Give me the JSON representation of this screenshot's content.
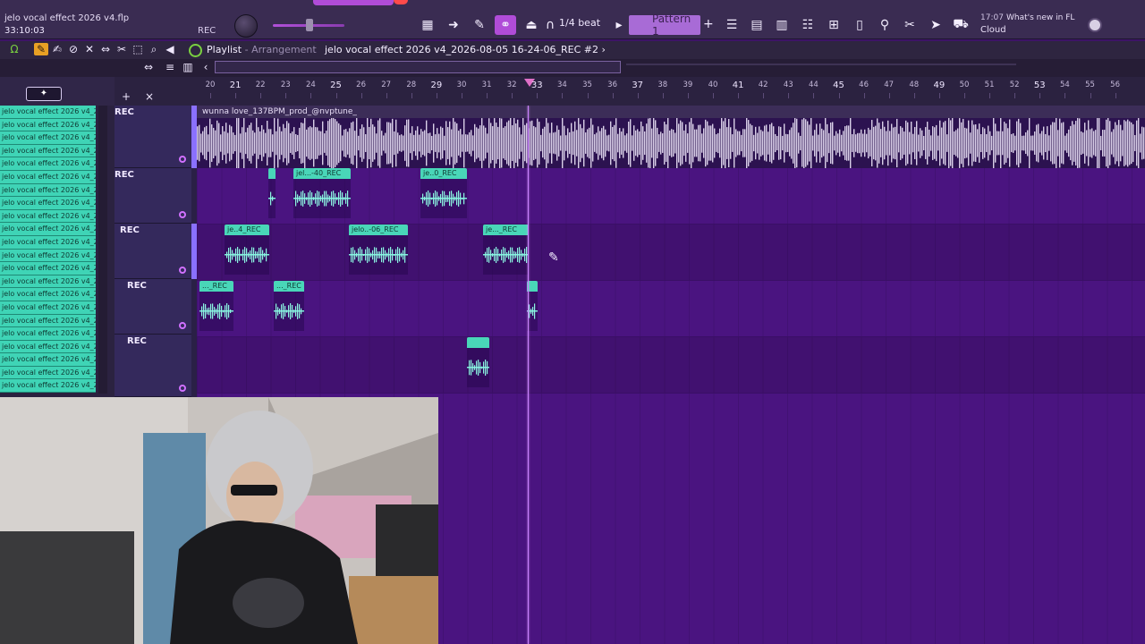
{
  "toolbar": {
    "file_title": "jelo vocal effect 2026 v4.flp",
    "elapsed": "33:10:03",
    "rec_label": "REC",
    "snap": "1/4 beat",
    "pattern": "Pattern 1",
    "news_time": "17:07",
    "news_title": "What's new in FL",
    "news_sub": "Cloud"
  },
  "playlist": {
    "title": "Playlist",
    "subtitle": "Arrangement",
    "file": "jelo vocal effect 2026 v4_2026-08-05 16-24-06_REC #2",
    "separator": " - ",
    "crumb": "›"
  },
  "ruler": {
    "numbers": [
      "20",
      "21",
      "22",
      "23",
      "24",
      "25",
      "26",
      "27",
      "28",
      "29",
      "30",
      "31",
      "32",
      "33",
      "34",
      "35",
      "36",
      "37",
      "38",
      "39",
      "40",
      "41",
      "42",
      "43",
      "44",
      "45",
      "46",
      "47",
      "48",
      "49",
      "50",
      "51",
      "52",
      "53",
      "54",
      "55",
      "56"
    ],
    "big": [
      "21",
      "25",
      "29",
      "33",
      "37",
      "41",
      "45",
      "49",
      "53"
    ]
  },
  "channels": {
    "item_label": "jelo vocal effect 2026 v4_2...",
    "count": 22
  },
  "tracks": {
    "top_controls": [
      "+",
      "×"
    ],
    "rec_labels": [
      "REC",
      "REC",
      "REC",
      "REC",
      "REC"
    ]
  },
  "audio": {
    "label": "wunna love_137BPM_prod_@nvptune_"
  },
  "clips": [
    {
      "label": "",
      "lane": 1,
      "start": 80,
      "width": 8
    },
    {
      "label": "jel...-40_REC",
      "lane": 1,
      "start": 108,
      "width": 64
    },
    {
      "label": "je..0_REC",
      "lane": 1,
      "start": 250,
      "width": 52
    },
    {
      "label": "je..4_REC",
      "lane": 2,
      "start": 31,
      "width": 50
    },
    {
      "label": "jelo..-06_REC",
      "lane": 2,
      "start": 170,
      "width": 66
    },
    {
      "label": "je..._REC",
      "lane": 2,
      "start": 320,
      "width": 51
    },
    {
      "label": "..._REC",
      "lane": 3,
      "start": 3,
      "width": 38
    },
    {
      "label": "..._REC",
      "lane": 3,
      "start": 86,
      "width": 34
    },
    {
      "label": "",
      "lane": 3,
      "start": 369,
      "width": 12
    },
    {
      "label": "",
      "lane": 4,
      "start": 302,
      "width": 25
    }
  ],
  "icons": {
    "accent": "#b04cd8",
    "clip_color": "#49d6b8",
    "grid_color": "#4a1480"
  }
}
